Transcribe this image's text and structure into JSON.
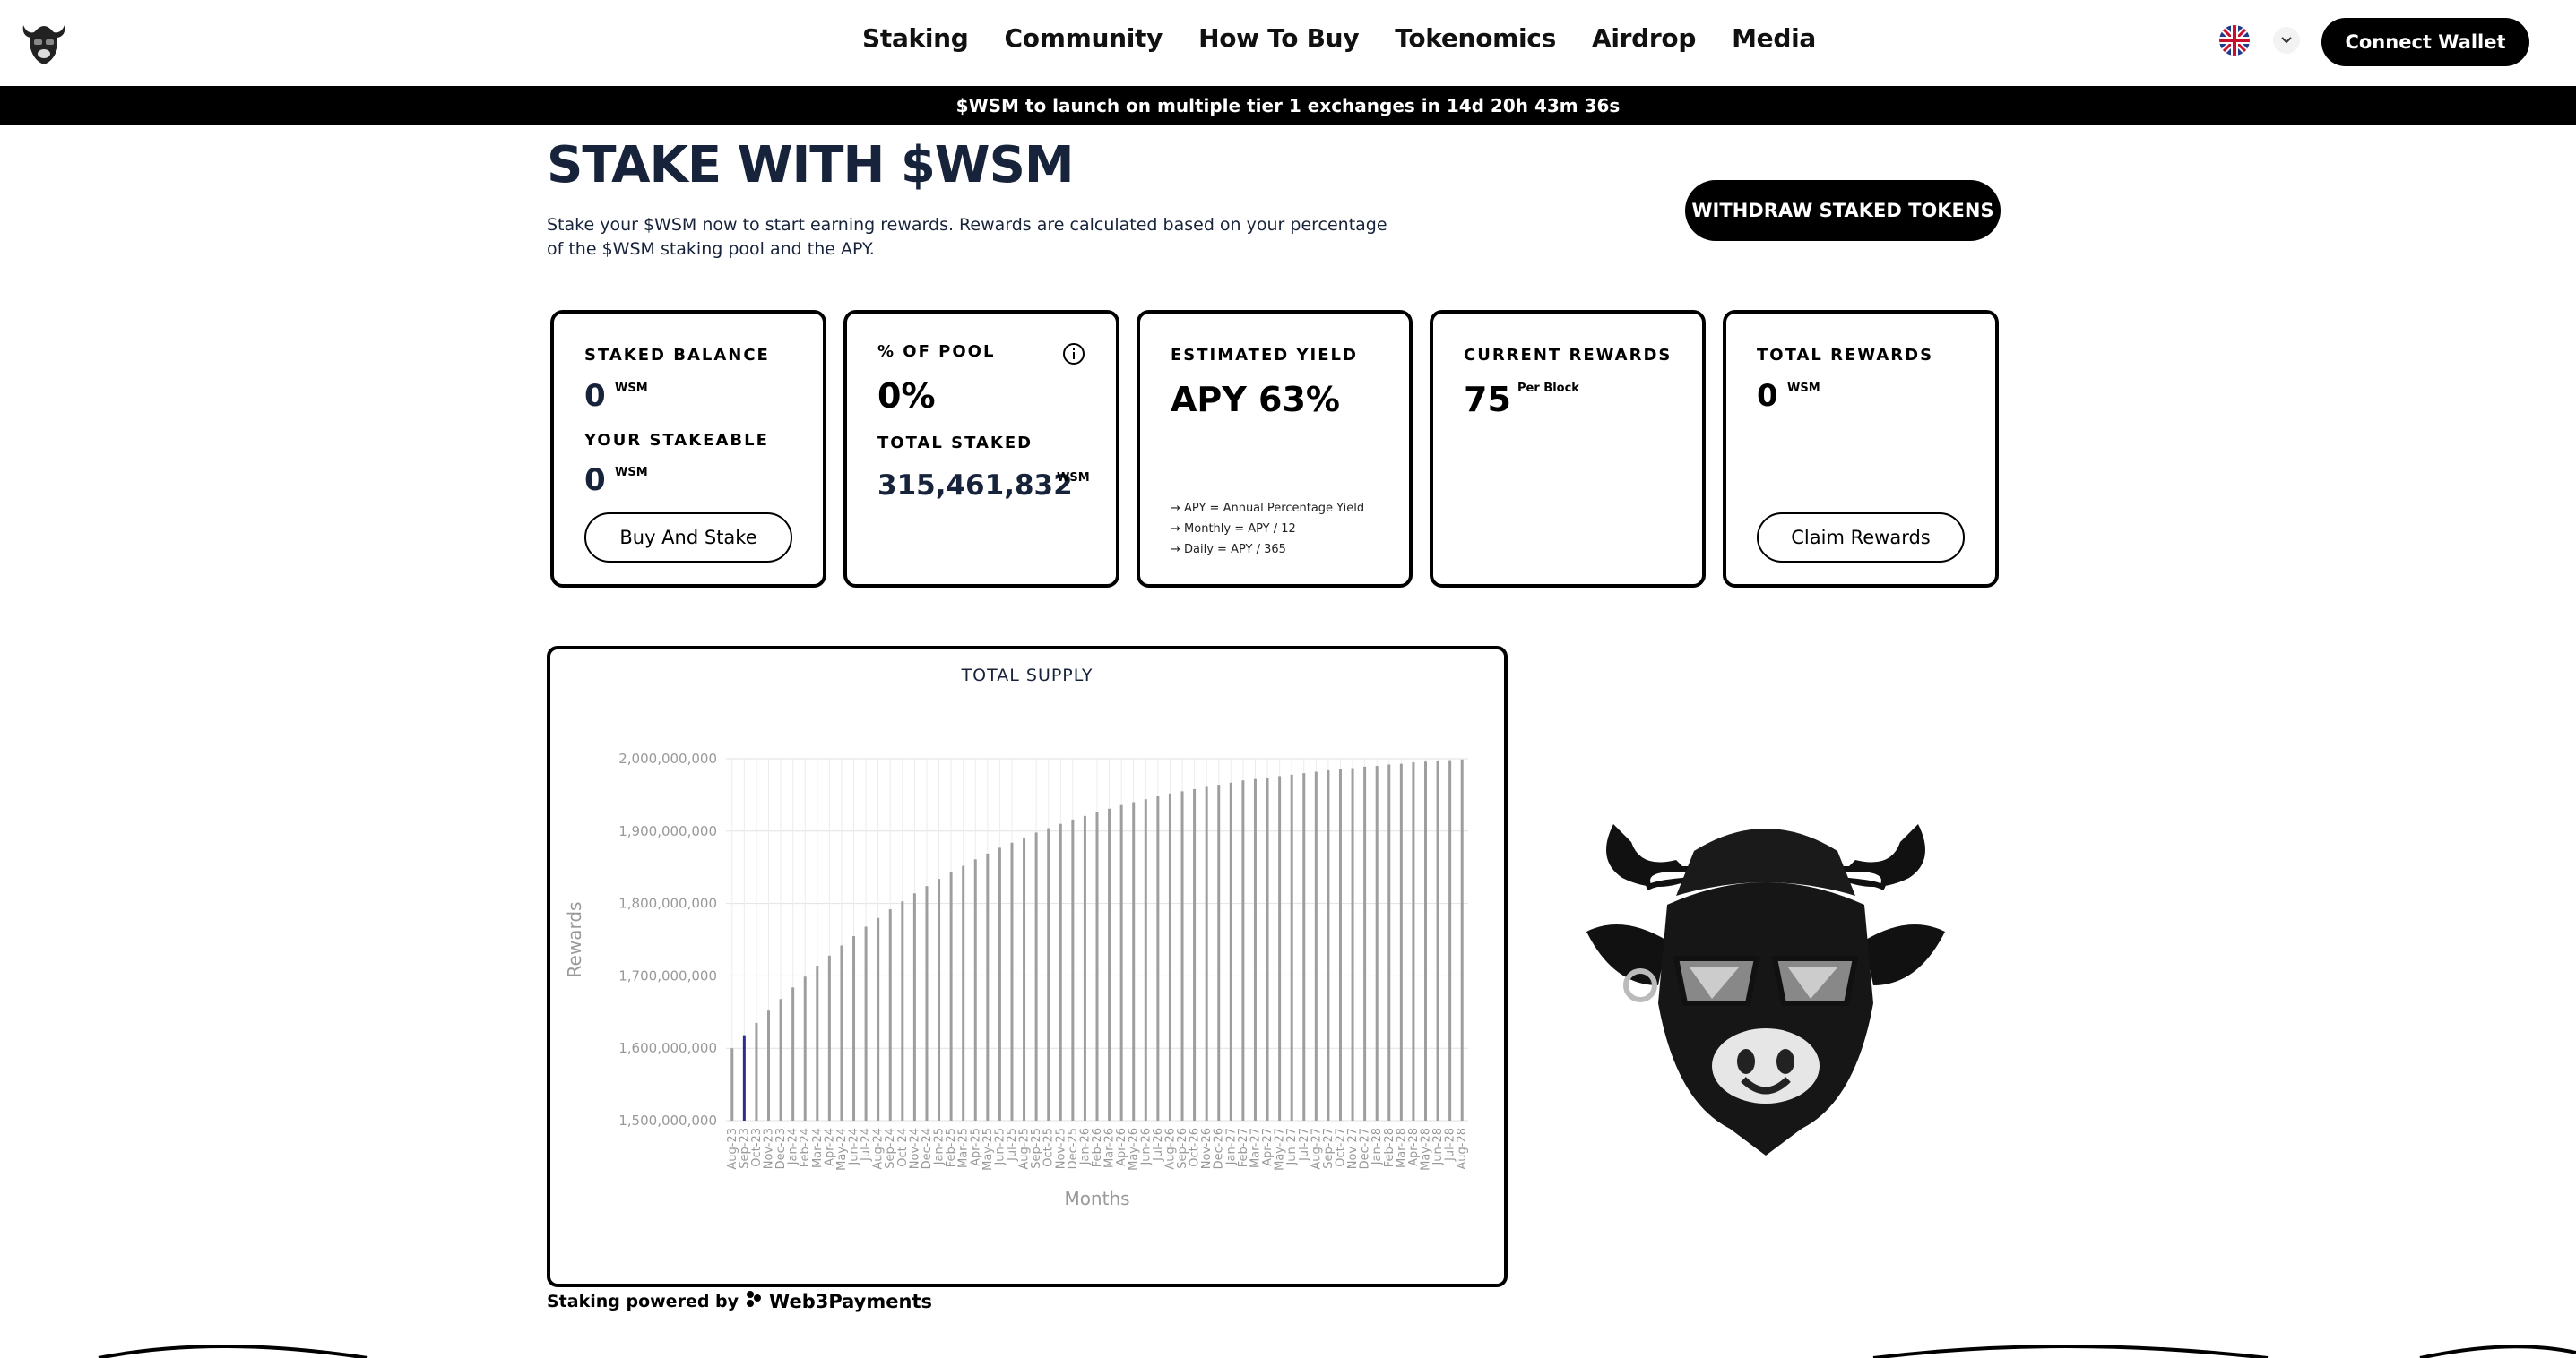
{
  "nav": {
    "items": [
      "Staking",
      "Community",
      "How To Buy",
      "Tokenomics",
      "Airdrop",
      "Media"
    ],
    "connect_label": "Connect Wallet"
  },
  "ticker": {
    "text": "$WSM to launch on multiple tier 1 exchanges in 14d 20h 43m 36s"
  },
  "hero": {
    "title": "STAKE WITH $WSM",
    "intro": "Stake your $WSM now to start earning rewards. Rewards are calculated based on your percentage of the $WSM staking pool and the APY.",
    "withdraw_label": "WITHDRAW STAKED TOKENS"
  },
  "cards": {
    "staked": {
      "label": "STAKED BALANCE",
      "value": "0",
      "unit": "WSM",
      "stakeable_label": "YOUR STAKEABLE",
      "stakeable_value": "0",
      "stakeable_unit": "WSM",
      "button": "Buy And Stake"
    },
    "pool": {
      "label": "% OF POOL",
      "value": "0%",
      "total_label": "TOTAL STAKED",
      "total_value": "315,461,832",
      "total_unit": "WSM"
    },
    "yield": {
      "label": "ESTIMATED YIELD",
      "value": "APY 63%",
      "notes": [
        "APY = Annual Percentage Yield",
        "Monthly = APY / 12",
        "Daily = APY / 365"
      ]
    },
    "current": {
      "label": "CURRENT REWARDS",
      "value": "75",
      "unit": "Per Block"
    },
    "total": {
      "label": "TOTAL REWARDS",
      "value": "0",
      "unit": "WSM",
      "button": "Claim Rewards"
    }
  },
  "footer": {
    "powered_by": "Staking powered by",
    "brand": "Web3Payments"
  },
  "colors": {
    "dark_navy": "#17233a",
    "highlight_bar": "#2b2d8f",
    "bar": "#9e9e9e",
    "grid": "#e2e2e2"
  },
  "chart_data": {
    "type": "bar",
    "title": "TOTAL SUPPLY",
    "xlabel": "Months",
    "ylabel": "Rewards",
    "ylim": [
      1500000000,
      2000000000
    ],
    "yticks": [
      "1,500,000,000",
      "1,600,000,000",
      "1,700,000,000",
      "1,800,000,000",
      "1,900,000,000",
      "2,000,000,000"
    ],
    "ytick_values": [
      1500000000,
      1600000000,
      1700000000,
      1800000000,
      1900000000,
      2000000000
    ],
    "categories": [
      "Aug-23",
      "Sep-23",
      "Oct-23",
      "Nov-23",
      "Dec-23",
      "Jan-24",
      "Feb-24",
      "Mar-24",
      "Apr-24",
      "May-24",
      "Jun-24",
      "Jul-24",
      "Aug-24",
      "Sep-24",
      "Oct-24",
      "Nov-24",
      "Dec-24",
      "Jan-25",
      "Feb-25",
      "Mar-25",
      "Apr-25",
      "May-25",
      "Jun-25",
      "Jul-25",
      "Aug-25",
      "Sep-25",
      "Oct-25",
      "Nov-25",
      "Dec-25",
      "Jan-26",
      "Feb-26",
      "Mar-26",
      "Apr-26",
      "May-26",
      "Jun-26",
      "Jul-26",
      "Aug-26",
      "Sep-26",
      "Oct-26",
      "Nov-26",
      "Dec-26",
      "Jan-27",
      "Feb-27",
      "Mar-27",
      "Apr-27",
      "May-27",
      "Jun-27",
      "Jul-27",
      "Aug-27",
      "Sep-27",
      "Oct-27",
      "Nov-27",
      "Dec-27",
      "Jan-28",
      "Feb-28",
      "Mar-28",
      "Apr-28",
      "May-28",
      "Jun-28",
      "Jul-28",
      "Aug-28"
    ],
    "values": [
      1600000000,
      1618000000,
      1635000000,
      1652000000,
      1668000000,
      1684000000,
      1699000000,
      1714000000,
      1728000000,
      1742000000,
      1755000000,
      1768000000,
      1780000000,
      1792000000,
      1803000000,
      1814000000,
      1824000000,
      1834000000,
      1843000000,
      1852000000,
      1861000000,
      1869000000,
      1877000000,
      1884000000,
      1891000000,
      1898000000,
      1904000000,
      1910000000,
      1916000000,
      1921000000,
      1926000000,
      1931000000,
      1936000000,
      1940000000,
      1944000000,
      1948000000,
      1952000000,
      1955000000,
      1958000000,
      1961000000,
      1964000000,
      1967000000,
      1970000000,
      1972000000,
      1974000000,
      1976000000,
      1978000000,
      1980000000,
      1982000000,
      1984000000,
      1986000000,
      1987000000,
      1989000000,
      1990000000,
      1992000000,
      1993000000,
      1995000000,
      1996000000,
      1997000000,
      1998000000,
      1999000000
    ],
    "highlight_index": 1,
    "grid": true,
    "legend": "none"
  }
}
